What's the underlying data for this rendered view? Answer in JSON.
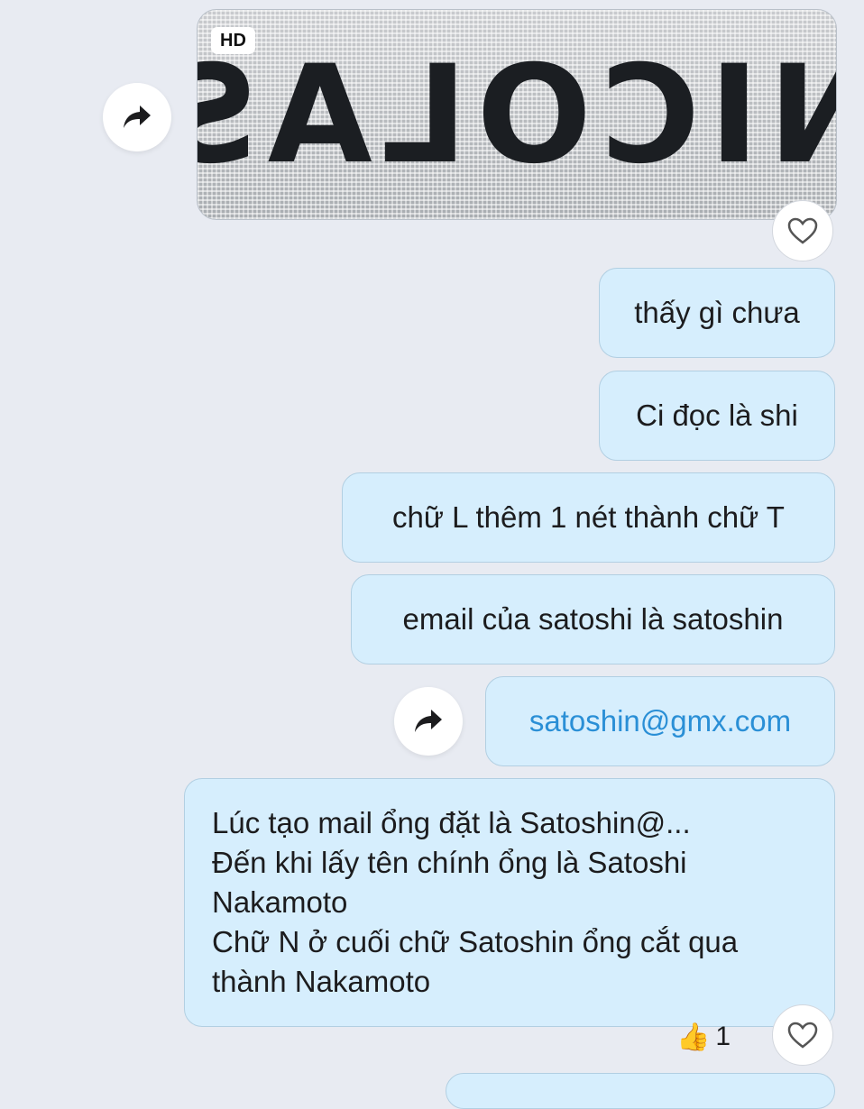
{
  "image_message": {
    "badge": "HD",
    "image_text": "NICOLAS",
    "liked": false
  },
  "messages": [
    {
      "text": "thấy gì chưa"
    },
    {
      "text": "Ci đọc là shi"
    },
    {
      "text": "chữ L thêm 1 nét thành chữ T"
    },
    {
      "text": "email của satoshi là satoshin"
    },
    {
      "text": "satoshin@gmx.com",
      "is_link": true
    },
    {
      "lines": [
        "Lúc tạo mail ổng đặt là Satoshin@...",
        "Đến khi lấy tên chính ổng là Satoshi",
        "Nakamoto",
        "Chữ N ở cuối chữ Satoshin ổng cắt qua",
        "thành Nakamoto"
      ]
    }
  ],
  "reaction": {
    "emoji": "👍",
    "count": "1"
  },
  "icons": {
    "share": "share-forward-icon",
    "heart": "heart-outline-icon",
    "thumbs": "thumbs-up-icon"
  },
  "colors": {
    "background": "#e8ebf2",
    "bubble": "#d6eefd",
    "bubble_border": "#b2cfe2",
    "link": "#2a8fd6"
  }
}
